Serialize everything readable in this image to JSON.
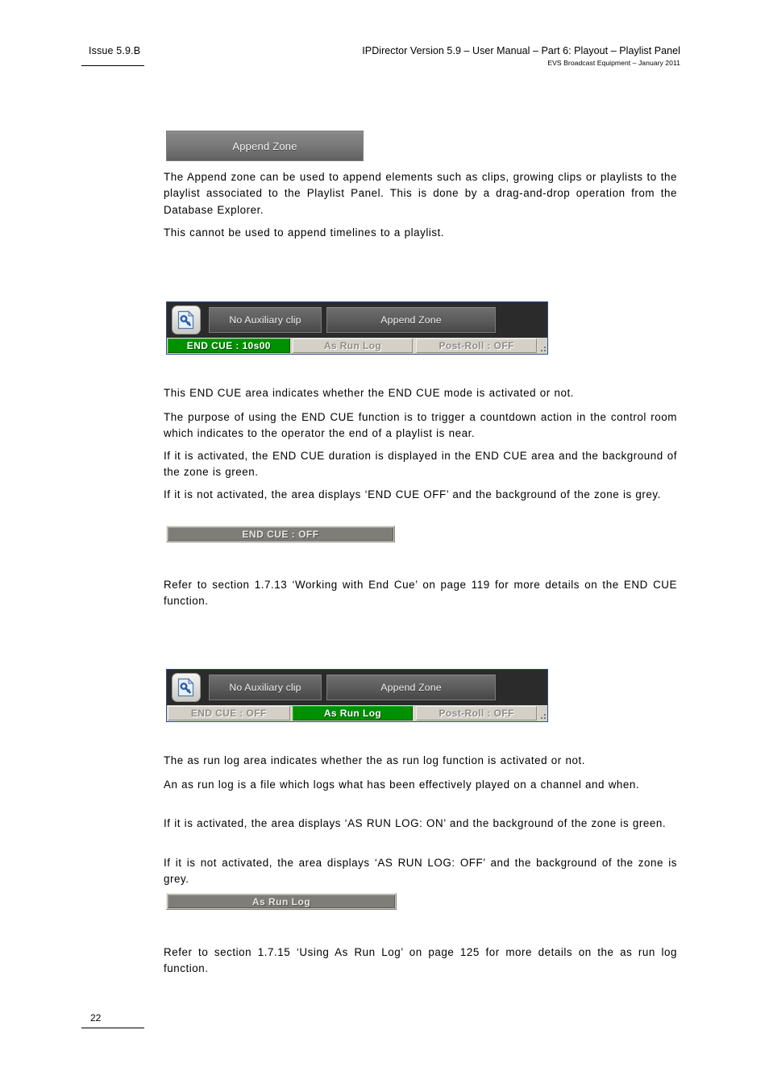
{
  "header": {
    "issue": "Issue 5.9.B",
    "title": "IPDirector Version 5.9 – User Manual – Part 6: Playout – Playlist Panel",
    "subtitle": "EVS Broadcast Equipment – January 2011"
  },
  "append_banner": {
    "label": "Append Zone"
  },
  "paragraphs": {
    "append_desc": "The Append zone can be used to append elements such as clips, growing clips or playlists to the playlist associated to the Playlist Panel. This is done by a drag-and-drop operation from the Database Explorer.",
    "append_note": "This cannot be used to append timelines to a playlist.",
    "endcue_intro": "This END CUE area indicates whether the END CUE mode is activated or not.",
    "endcue_purpose": "The purpose of using the END CUE function is to trigger a countdown action in the control room which indicates to the operator the end of a playlist is near.",
    "endcue_active": "If it is activated, the END CUE duration is displayed in the END CUE area and the background of the zone is green.",
    "endcue_inactive": "If it is not activated, the area displays ‘END CUE OFF’ and the background of the zone is grey.",
    "endcue_refer": "Refer to section 1.7.13 ‘Working with End Cue’ on page 119 for more details on the END CUE function.",
    "arl_intro": "The as run log area indicates whether the as run log function is activated or not.",
    "arl_definition": "An as run log is a file which logs what has been effectively played on a channel and when.",
    "arl_active": "If it is activated, the area displays ‘AS RUN LOG: ON’ and the background of the zone is green.",
    "arl_inactive": "If it is not activated, the area displays ‘AS RUN LOG: OFF’ and the background of the zone is grey.",
    "arl_refer": "Refer to section 1.7.15 ‘Using As Run Log’ on page 125 for more details on the as run log function."
  },
  "panel_endcue": {
    "icon": "key-document-icon",
    "aux_button": "No Auxiliary clip",
    "append_button": "Append Zone",
    "status": {
      "end_cue": "END CUE : 10s00",
      "end_cue_state": "on",
      "as_run_log": "As Run Log",
      "as_run_log_state": "off",
      "post_roll": "Post-Roll : OFF",
      "post_roll_state": "off"
    }
  },
  "panel_arl": {
    "icon": "key-document-icon",
    "aux_button": "No Auxiliary clip",
    "append_button": "Append Zone",
    "status": {
      "end_cue": "END CUE : OFF",
      "end_cue_state": "off",
      "as_run_log": "As Run Log",
      "as_run_log_state": "on",
      "post_roll": "Post-Roll : OFF",
      "post_roll_state": "off"
    }
  },
  "grey_bars": {
    "end_cue_off": "END CUE : OFF",
    "as_run_log": "As Run Log"
  },
  "footer": {
    "page_number": "22"
  },
  "colors": {
    "active_green": "#009000",
    "panel_dark": "#2b2b2b",
    "panel_border_blue": "#2f4f86",
    "status_grey": "#d4d0c8"
  }
}
